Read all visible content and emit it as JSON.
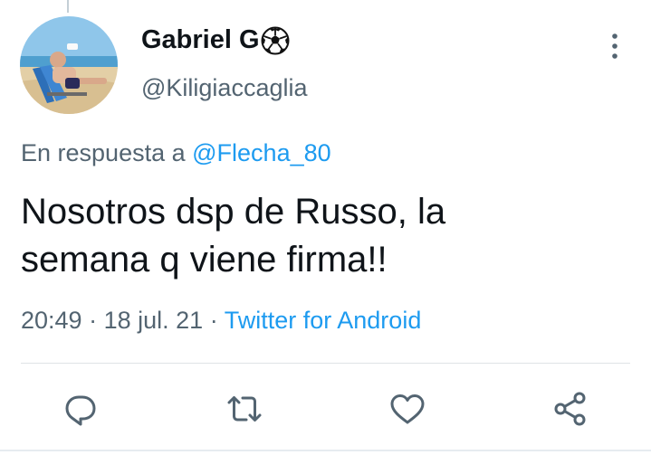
{
  "tweet": {
    "author": {
      "display_name": "Gabriel G",
      "display_name_emoji": "soccer-ball-icon",
      "handle": "@Kiligiaccaglia"
    },
    "reply_context": {
      "prefix": "En respuesta a",
      "mention": "@Flecha_80"
    },
    "text_lines": [
      "Nosotros dsp de Russo, la",
      "semana q viene firma!!"
    ],
    "time": "20:49",
    "date": "18 jul. 21",
    "separator": "·",
    "source": "Twitter for Android"
  },
  "actions": [
    {
      "name": "reply",
      "icon": "reply-icon"
    },
    {
      "name": "retweet",
      "icon": "retweet-icon"
    },
    {
      "name": "like",
      "icon": "heart-icon"
    },
    {
      "name": "share",
      "icon": "share-icon"
    }
  ],
  "colors": {
    "text": "#0f1419",
    "secondary": "#536471",
    "accent": "#1d9bf0",
    "icon": "#536471",
    "divider": "#dfe3e6"
  }
}
